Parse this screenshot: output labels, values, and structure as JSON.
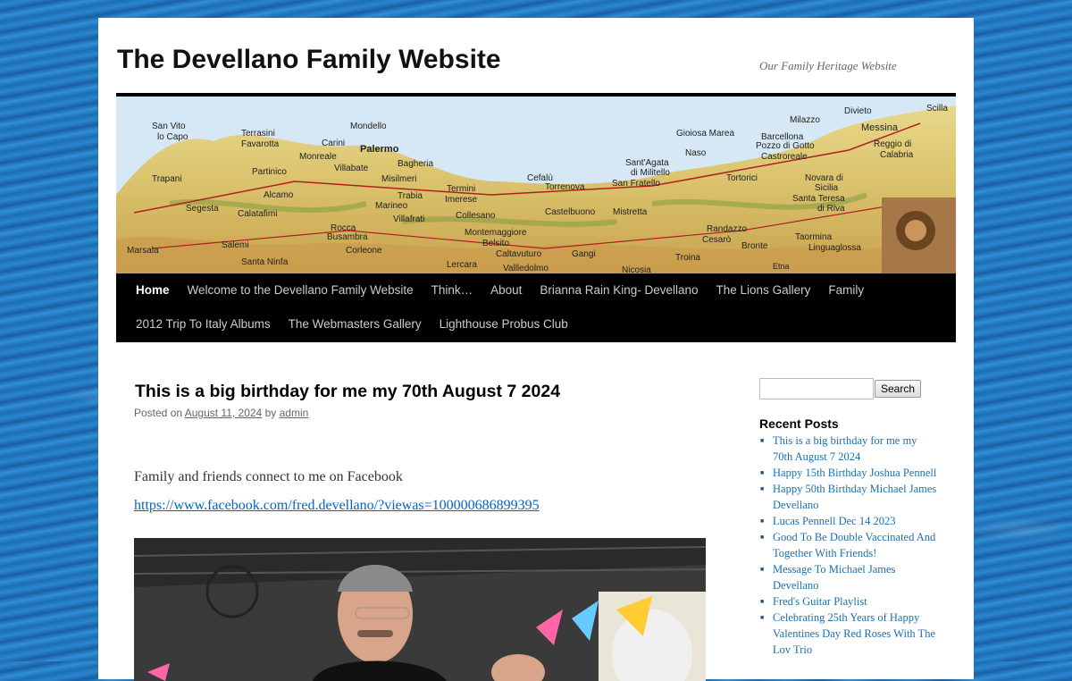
{
  "site": {
    "title": "The Devellano Family Website",
    "description": "Our Family Heritage Website"
  },
  "banner": {
    "places": [
      "San Vito lo Capo",
      "Terrasini",
      "Favarotta",
      "Mondello",
      "Carini",
      "Palermo",
      "Monreale",
      "Bagheria",
      "Villabate",
      "Misilmeri",
      "Trapani",
      "Partinico",
      "Alcamo",
      "Trabia",
      "Termini Imerese",
      "Cefalù",
      "Gioiosa Marea",
      "Barcellona",
      "Pozzo di Gotto",
      "Castroreale",
      "Milazzo",
      "Divieto",
      "Messina",
      "Reggio di Calabria",
      "Sant'Agata di Militello",
      "Naso",
      "Torrenova",
      "San Fratello",
      "Tortorici",
      "Novara di Sicilia",
      "Santa Teresa di Riva",
      "Segesta",
      "Calatafimi",
      "Marineo",
      "Villafrati",
      "Collesano",
      "Castelbuono",
      "Mistretta",
      "Randazzo",
      "Cesarò",
      "Bronte",
      "Taormina",
      "Linguaglossa",
      "Rocca Busambra",
      "Corleone",
      "Salemi",
      "Marsala",
      "Santa Ninfa",
      "Lercara",
      "Montemaggiore Belsito",
      "Caltavuturo",
      "Gangi",
      "Vallledolmo",
      "Nicosia",
      "Troina",
      "Etna",
      "Scilla"
    ]
  },
  "nav": {
    "row1": [
      "Home",
      "Welcome to the Devellano Family Website",
      "Think…",
      "About",
      "Brianna Rain King- Devellano",
      "The Lions Gallery",
      "Family"
    ],
    "row2": [
      "2012 Trip To Italy Albums",
      "The Webmasters Gallery",
      "Lighthouse Probus Club"
    ]
  },
  "post": {
    "title": "This is a big birthday for me my 70th August 7 2024",
    "posted_on": "Posted on",
    "date": "August 11, 2024",
    "by": "by",
    "author": "admin",
    "body": "Family and friends connect to me on Facebook",
    "link": "https://www.facebook.com/fred.devellano/?viewas=100000686899395"
  },
  "sidebar": {
    "search_placeholder": "",
    "search_button": "Search",
    "recent_heading": "Recent Posts",
    "recent_posts": [
      "This is a big birthday for me my 70th August 7 2024",
      "Happy 15th Birthday Joshua Pennell",
      "Happy 50th Birthday Michael James Devellano",
      "Lucas Pennell Dec 14 2023",
      "Good To Be Double Vaccinated And Together With Friends!",
      "Message To Michael James Devellano",
      "Fred's Guitar Playlist",
      "Celebrating 25th Years of Happy Valentines Day Red Roses With The Lov Trio"
    ]
  }
}
